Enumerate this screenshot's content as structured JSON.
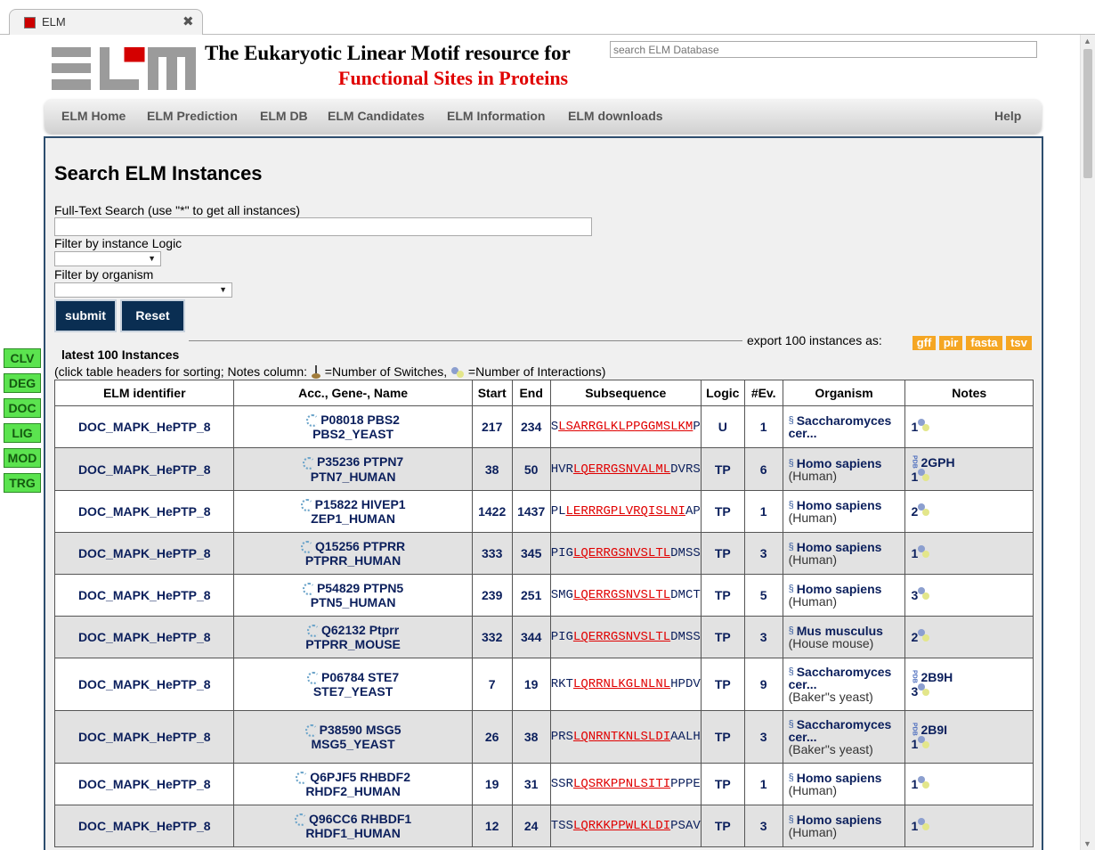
{
  "browser": {
    "tab_title": "ELM",
    "close_glyph": "✖"
  },
  "header": {
    "title_line1": "The Eukaryotic Linear Motif resource for",
    "title_line2": "Functional Sites in Proteins",
    "search_placeholder": "search ELM Database",
    "logo_color": "#9b9b9b",
    "logo_accent": "#d40000"
  },
  "nav": {
    "items": [
      "ELM Home",
      "ELM Prediction",
      "ELM DB",
      "ELM Candidates",
      "ELM Information",
      "ELM downloads"
    ],
    "help": "Help"
  },
  "side_buttons": [
    "CLV",
    "DEG",
    "DOC",
    "LIG",
    "MOD",
    "TRG"
  ],
  "search_form": {
    "title": "Search ELM Instances",
    "fulltext_label": "Full-Text Search (use \"*\" to get all instances)",
    "logic_label": "Filter by instance Logic",
    "organism_label": "Filter by organism",
    "submit_label": "submit",
    "reset_label": "Reset"
  },
  "results": {
    "title": "latest 100 Instances",
    "export_label": "export 100 instances as:",
    "export_formats": [
      "gff",
      "pir",
      "fasta",
      "tsv"
    ],
    "hint_prefix": "(click table headers for sorting; Notes column: ",
    "hint_switches": "=Number of Switches, ",
    "hint_interactions": "=Number of Interactions)",
    "columns": [
      "ELM identifier",
      "Acc., Gene-, Name",
      "Start",
      "End",
      "Subsequence",
      "Logic",
      "#Ev.",
      "Organism",
      "Notes"
    ],
    "rows": [
      {
        "elm": "DOC_MAPK_HePTP_8",
        "acc": "P08018 PBS2",
        "name": "PBS2_YEAST",
        "start": "217",
        "end": "234",
        "pre": "S",
        "hit": "LSARRGLKLPPGGMSLKM",
        "post": "P",
        "logic": "U",
        "ev": "1",
        "species": "Saccharomyces cer...",
        "common": "",
        "pdb": "",
        "interactions": "1"
      },
      {
        "elm": "DOC_MAPK_HePTP_8",
        "acc": "P35236 PTPN7",
        "name": "PTN7_HUMAN",
        "start": "38",
        "end": "50",
        "pre": "HVR",
        "hit": "LQERRGSNVALML",
        "post": "DVRS",
        "logic": "TP",
        "ev": "6",
        "species": "Homo sapiens",
        "common": "(Human)",
        "pdb": "2GPH",
        "interactions": "1"
      },
      {
        "elm": "DOC_MAPK_HePTP_8",
        "acc": "P15822 HIVEP1",
        "name": "ZEP1_HUMAN",
        "start": "1422",
        "end": "1437",
        "pre": "PL",
        "hit": "LERRRGPLVRQISLNI",
        "post": "AP",
        "logic": "TP",
        "ev": "1",
        "species": "Homo sapiens",
        "common": "(Human)",
        "pdb": "",
        "interactions": "2"
      },
      {
        "elm": "DOC_MAPK_HePTP_8",
        "acc": "Q15256 PTPRR",
        "name": "PTPRR_HUMAN",
        "start": "333",
        "end": "345",
        "pre": "PIG",
        "hit": "LQERRGSNVSLTL",
        "post": "DMSS",
        "logic": "TP",
        "ev": "3",
        "species": "Homo sapiens",
        "common": "(Human)",
        "pdb": "",
        "interactions": "1"
      },
      {
        "elm": "DOC_MAPK_HePTP_8",
        "acc": "P54829 PTPN5",
        "name": "PTN5_HUMAN",
        "start": "239",
        "end": "251",
        "pre": "SMG",
        "hit": "LQERRGSNVSLTL",
        "post": "DMCT",
        "logic": "TP",
        "ev": "5",
        "species": "Homo sapiens",
        "common": "(Human)",
        "pdb": "",
        "interactions": "3"
      },
      {
        "elm": "DOC_MAPK_HePTP_8",
        "acc": "Q62132 Ptprr",
        "name": "PTPRR_MOUSE",
        "start": "332",
        "end": "344",
        "pre": "PIG",
        "hit": "LQERRGSNVSLTL",
        "post": "DMSS",
        "logic": "TP",
        "ev": "3",
        "species": "Mus musculus",
        "common": "(House mouse)",
        "pdb": "",
        "interactions": "2"
      },
      {
        "elm": "DOC_MAPK_HePTP_8",
        "acc": "P06784 STE7",
        "name": "STE7_YEAST",
        "start": "7",
        "end": "19",
        "pre": "RKT",
        "hit": "LQRRNLKGLNLNL",
        "post": "HPDV",
        "logic": "TP",
        "ev": "9",
        "species": "Saccharomyces cer...",
        "common": "(Baker\"s yeast)",
        "pdb": "2B9H",
        "interactions": "3"
      },
      {
        "elm": "DOC_MAPK_HePTP_8",
        "acc": "P38590 MSG5",
        "name": "MSG5_YEAST",
        "start": "26",
        "end": "38",
        "pre": "PRS",
        "hit": "LQNRNTKNLSLDI",
        "post": "AALH",
        "logic": "TP",
        "ev": "3",
        "species": "Saccharomyces cer...",
        "common": "(Baker\"s yeast)",
        "pdb": "2B9I",
        "interactions": "1"
      },
      {
        "elm": "DOC_MAPK_HePTP_8",
        "acc": "Q6PJF5 RHBDF2",
        "name": "RHDF2_HUMAN",
        "start": "19",
        "end": "31",
        "pre": "SSR",
        "hit": "LQSRKPPNLSITI",
        "post": "PPPE",
        "logic": "TP",
        "ev": "1",
        "species": "Homo sapiens",
        "common": "(Human)",
        "pdb": "",
        "interactions": "1"
      },
      {
        "elm": "DOC_MAPK_HePTP_8",
        "acc": "Q96CC6 RHBDF1",
        "name": "RHDF1_HUMAN",
        "start": "12",
        "end": "24",
        "pre": "TSS",
        "hit": "LQRKKPPWLKLDI",
        "post": "PSAV",
        "logic": "TP",
        "ev": "3",
        "species": "Homo sapiens",
        "common": "(Human)",
        "pdb": "",
        "interactions": "1"
      }
    ]
  },
  "colors": {
    "side_button": "#5be34f",
    "export": "#f5a623",
    "form_button": "#0a2e52",
    "panel_border": "#2d4d6e",
    "alt_row": "#e2e2e2",
    "link": "#0b1f5c",
    "highlight": "#e00000"
  }
}
